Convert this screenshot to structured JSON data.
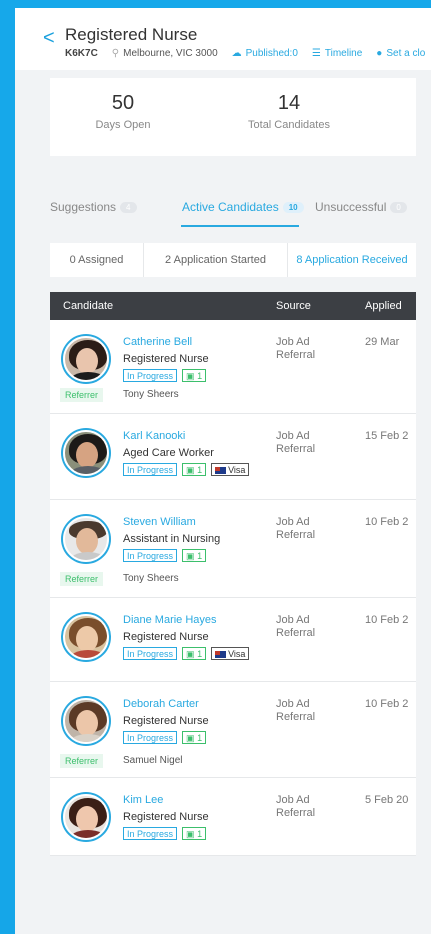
{
  "header": {
    "back": "<",
    "title": "Registered Nurse",
    "code": "K6K7C",
    "location": "Melbourne, VIC 3000",
    "published": "Published:0",
    "timeline": "Timeline",
    "set_close": "Set a clo"
  },
  "stats": [
    {
      "value": "50",
      "label": "Days Open"
    },
    {
      "value": "14",
      "label": "Total Candidates"
    }
  ],
  "tabs": [
    {
      "label": "Suggestions",
      "count": "4"
    },
    {
      "label": "Active Candidates",
      "count": "10"
    },
    {
      "label": "Unsuccessful",
      "count": "0"
    }
  ],
  "filters": [
    "0 Assigned",
    "2 Application Started",
    "8 Application Received"
  ],
  "table": {
    "headers": [
      "Candidate",
      "Source",
      "Applied"
    ],
    "rows": [
      {
        "name": "Catherine Bell",
        "role": "Registered Nurse",
        "status": "In Progress",
        "count": "1",
        "visa": "",
        "referrer": "Referrer",
        "referrer_name": "Tony Sheers",
        "source1": "Job Ad",
        "source2": "Referral",
        "applied": "29 Mar"
      },
      {
        "name": "Karl Kanooki",
        "role": "Aged Care Worker",
        "status": "In Progress",
        "count": "1",
        "visa": "Visa",
        "referrer": "",
        "referrer_name": "",
        "source1": "Job Ad",
        "source2": "Referral",
        "applied": "15 Feb 2"
      },
      {
        "name": "Steven William",
        "role": "Assistant in Nursing",
        "status": "In Progress",
        "count": "1",
        "visa": "",
        "referrer": "Referrer",
        "referrer_name": "Tony Sheers",
        "source1": "Job Ad",
        "source2": "Referral",
        "applied": "10 Feb 2"
      },
      {
        "name": "Diane Marie Hayes",
        "role": "Registered Nurse",
        "status": "In Progress",
        "count": "1",
        "visa": "Visa",
        "referrer": "",
        "referrer_name": "",
        "source1": "Job Ad",
        "source2": "Referral",
        "applied": "10 Feb 2"
      },
      {
        "name": "Deborah Carter",
        "role": "Registered Nurse",
        "status": "In Progress",
        "count": "1",
        "visa": "",
        "referrer": "Referrer",
        "referrer_name": "Samuel Nigel",
        "source1": "Job Ad",
        "source2": "Referral",
        "applied": "10 Feb 2"
      },
      {
        "name": "Kim Lee",
        "role": "Registered Nurse",
        "status": "In Progress",
        "count": "1",
        "visa": "",
        "referrer": "",
        "referrer_name": "",
        "source1": "Job Ad",
        "source2": "Referral",
        "applied": "5 Feb 20"
      }
    ]
  },
  "colors": {
    "accent": "#29a9e0",
    "brand_blue": "#16a8ea",
    "green": "#3cbf6c",
    "header_dark": "#3c3f44"
  }
}
